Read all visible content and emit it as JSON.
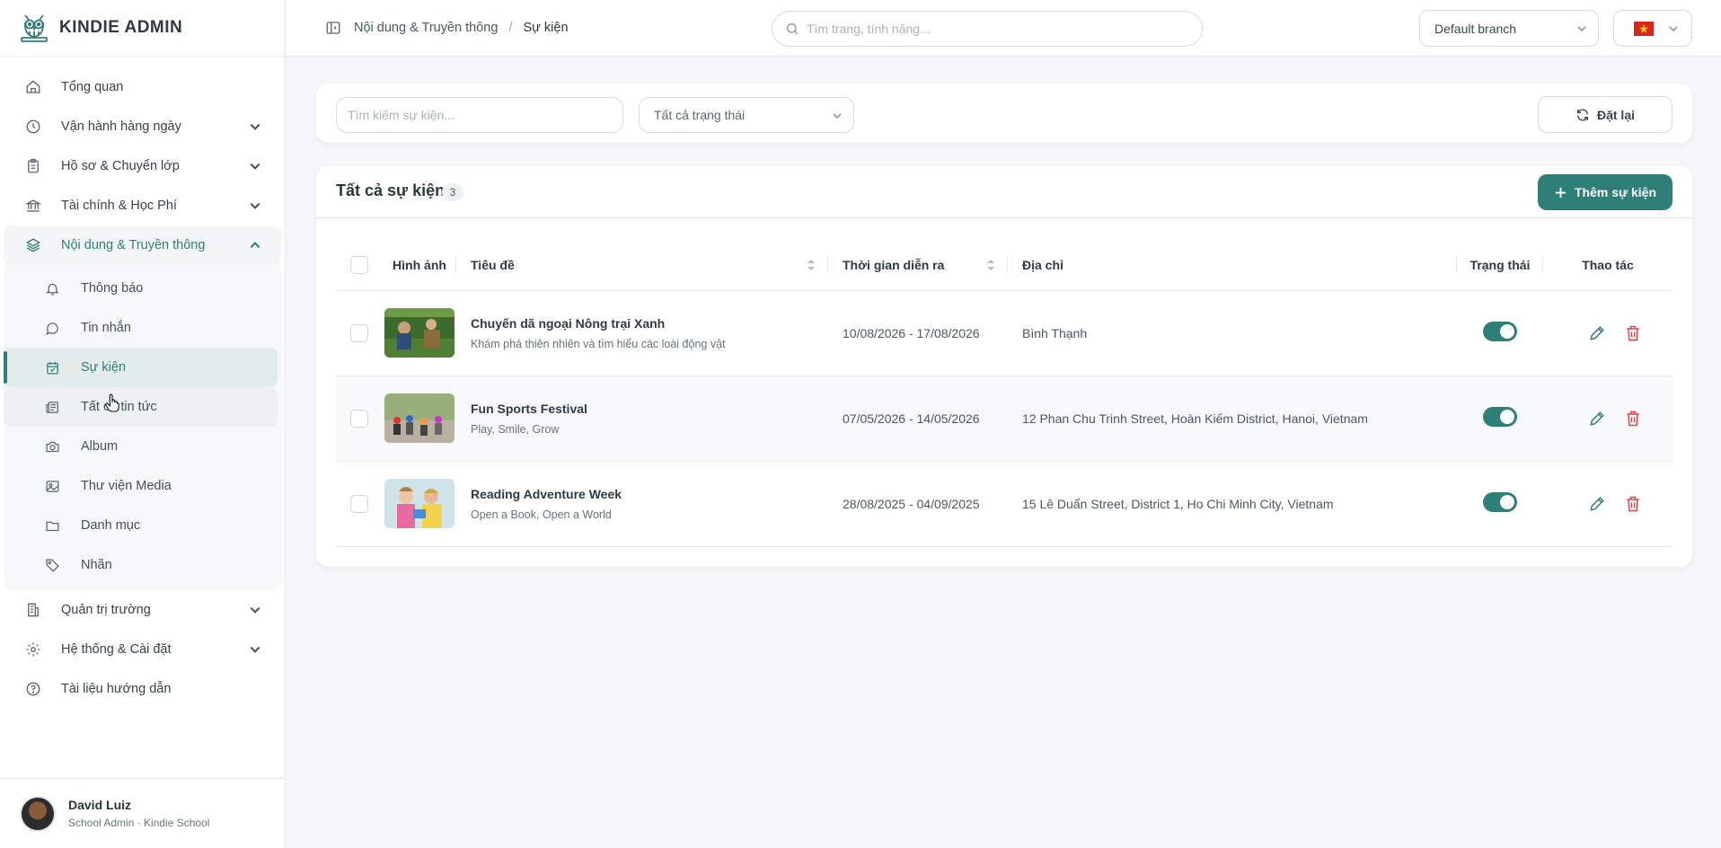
{
  "brand": {
    "name": "KINDIE ADMIN",
    "logo_icon": "owl-logo-icon"
  },
  "sidebar": {
    "items_top": [
      {
        "label": "Tổng quan",
        "icon": "home-icon"
      },
      {
        "label": "Vận hành hàng ngày",
        "icon": "clock-icon"
      },
      {
        "label": "Hồ sơ & Chuyển lớp",
        "icon": "clipboard-icon"
      },
      {
        "label": "Tài chính & Học Phí",
        "icon": "bank-icon"
      },
      {
        "label": "Nội dung & Truyền thông",
        "icon": "layers-icon",
        "expanded": true
      }
    ],
    "sub_items": [
      {
        "label": "Thông báo",
        "icon": "bell-icon"
      },
      {
        "label": "Tin nhắn",
        "icon": "chat-icon"
      },
      {
        "label": "Sự kiện",
        "icon": "calendar-check-icon",
        "active": true
      },
      {
        "label": "Tất cả tin tức",
        "icon": "newspaper-icon"
      },
      {
        "label": "Album",
        "icon": "camera-icon"
      },
      {
        "label": "Thư viện Media",
        "icon": "image-icon"
      },
      {
        "label": "Danh mục",
        "icon": "folder-icon"
      },
      {
        "label": "Nhãn",
        "icon": "tag-icon"
      }
    ],
    "items_bottom": [
      {
        "label": "Quản trị trường",
        "icon": "building-icon"
      },
      {
        "label": "Hệ thống & Cài đặt",
        "icon": "gear-icon"
      },
      {
        "label": "Tài liệu hướng dẫn",
        "icon": "help-circle-icon"
      }
    ]
  },
  "user": {
    "name": "David Luiz",
    "role": "School Admin · Kindie School"
  },
  "topbar": {
    "breadcrumb": {
      "parent": "Nội dung & Truyền thông",
      "separator": "/",
      "current": "Sự kiện"
    },
    "search_placeholder": "Tìm trang, tính năng...",
    "branch": "Default branch",
    "language_flag": "vietnam-flag-icon"
  },
  "filters": {
    "search_placeholder": "Tìm kiếm sự kiện...",
    "status": "Tất cả trạng thái",
    "reset_label": "Đặt lại"
  },
  "events_card": {
    "title": "Tất cả sự kiện",
    "count": "3",
    "add_label": "Thêm sự kiện",
    "columns": {
      "image": "Hình ảnh",
      "title": "Tiêu đề",
      "time": "Thời gian diễn ra",
      "address": "Địa chỉ",
      "status": "Trạng thái",
      "actions": "Thao tác"
    },
    "rows": [
      {
        "title": "Chuyến dã ngoại Nông trại Xanh",
        "subtitle": "Khám phá thiên nhiên và tìm hiểu các loài động vật",
        "time": "10/08/2026 - 17/08/2026",
        "address": "Bình Thạnh",
        "active": true
      },
      {
        "title": "Fun Sports Festival",
        "subtitle": "Play, Smile, Grow",
        "time": "07/05/2026 - 14/05/2026",
        "address": "12 Phan Chu Trinh Street, Hoàn Kiếm District, Hanoi, Vietnam",
        "active": true
      },
      {
        "title": "Reading Adventure Week",
        "subtitle": "Open a Book, Open a World",
        "time": "28/08/2025 - 04/09/2025",
        "address": "15 Lê Duẩn Street, District 1, Ho Chi Minh City, Vietnam",
        "active": true
      }
    ]
  },
  "colors": {
    "accent": "#2f7f79",
    "danger": "#e0424b",
    "background": "#f4f6f8"
  }
}
